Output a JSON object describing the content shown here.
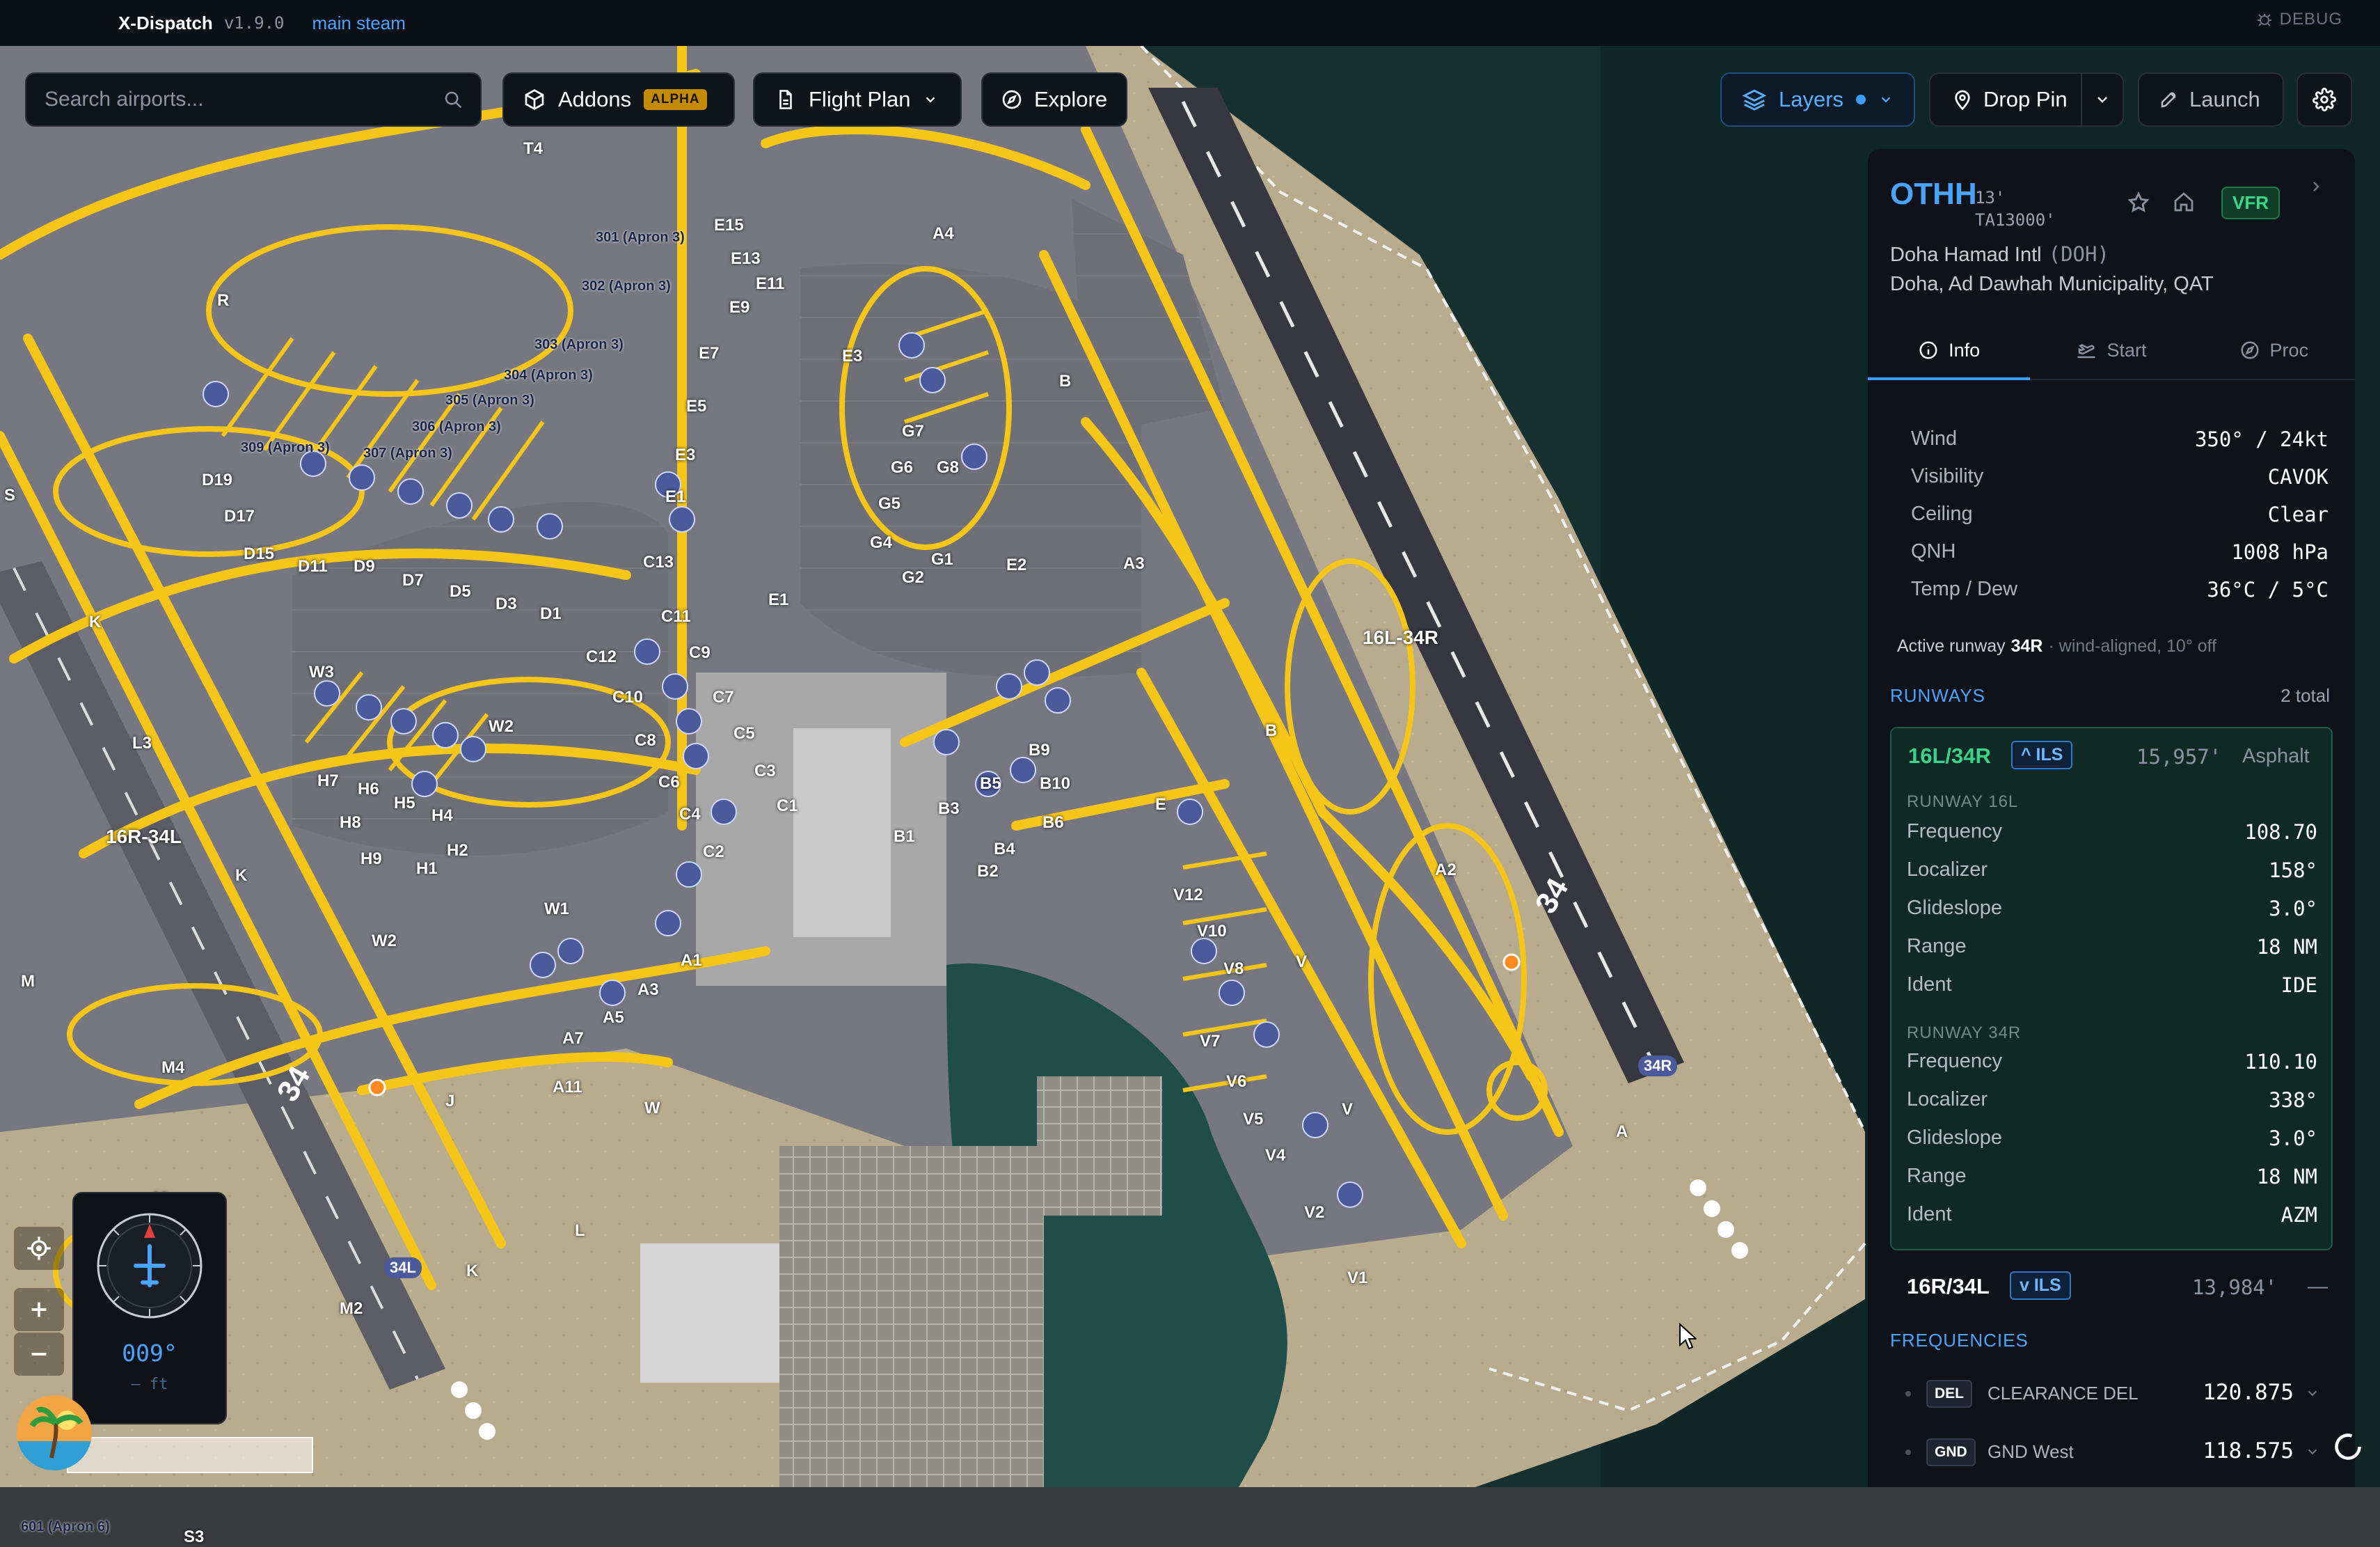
{
  "titlebar": {
    "app": "X-Dispatch",
    "version": "v1.9.0",
    "branch": "main steam",
    "debug": "DEBUG"
  },
  "toolbar": {
    "search_placeholder": "Search airports...",
    "addons": "Addons",
    "addons_badge": "ALPHA",
    "flight_plan": "Flight Plan",
    "explore": "Explore",
    "layers": "Layers",
    "drop_pin": "Drop Pin",
    "launch": "Launch"
  },
  "airport": {
    "icao": "OTHH",
    "elevation": "13'",
    "transition": "TA13000'",
    "flight_rules": "VFR",
    "name": "Doha Hamad Intl",
    "iata": "(DOH)",
    "location": "Doha, Ad Dawhah Municipality, QAT"
  },
  "tabs": [
    {
      "label": "Info",
      "icon": "info-icon"
    },
    {
      "label": "Start",
      "icon": "takeoff-icon"
    },
    {
      "label": "Proc",
      "icon": "compass-icon"
    }
  ],
  "weather": [
    {
      "k": "Wind",
      "v": "350° / 24kt"
    },
    {
      "k": "Visibility",
      "v": "CAVOK"
    },
    {
      "k": "Ceiling",
      "v": "Clear"
    },
    {
      "k": "QNH",
      "v": "1008 hPa"
    },
    {
      "k": "Temp / Dew",
      "v": "36°C / 5°C"
    }
  ],
  "active_runway": {
    "label": "Active runway",
    "value": "34R",
    "note": "· wind-aligned, 10° off"
  },
  "runways_header": {
    "title": "RUNWAYS",
    "count": "2 total"
  },
  "runway1": {
    "id": "16L/34R",
    "ils": "^ ILS",
    "length": "15,957'",
    "surface": "Asphalt",
    "ends": [
      {
        "title": "RUNWAY 16L",
        "rows": [
          {
            "k": "Frequency",
            "v": "108.70"
          },
          {
            "k": "Localizer",
            "v": "158°"
          },
          {
            "k": "Glideslope",
            "v": "3.0°"
          },
          {
            "k": "Range",
            "v": "18 NM"
          },
          {
            "k": "Ident",
            "v": "IDE"
          }
        ]
      },
      {
        "title": "RUNWAY 34R",
        "rows": [
          {
            "k": "Frequency",
            "v": "110.10"
          },
          {
            "k": "Localizer",
            "v": "338°"
          },
          {
            "k": "Glideslope",
            "v": "3.0°"
          },
          {
            "k": "Range",
            "v": "18 NM"
          },
          {
            "k": "Ident",
            "v": "AZM"
          }
        ]
      }
    ]
  },
  "runway2": {
    "id": "16R/34L",
    "ils": "v ILS",
    "length": "13,984'",
    "surface": "—"
  },
  "frequencies_header": "FREQUENCIES",
  "frequencies": [
    {
      "tag": "DEL",
      "name": "CLEARANCE DEL",
      "value": "120.875"
    },
    {
      "tag": "GND",
      "name": "GND West",
      "value": "118.575"
    }
  ],
  "compass": {
    "heading": "009°",
    "altitude": "— ft"
  },
  "map_labels": {
    "runway_main": "16L-34R",
    "runway_west": "16R-34L",
    "rw_num_east": "34",
    "rw_num_west": "34",
    "threshold_east": "34R",
    "threshold_west": "34L",
    "taxiways": [
      {
        "t": "T4"
      },
      {
        "t": "R"
      },
      {
        "t": "S"
      },
      {
        "t": "K"
      },
      {
        "t": "L3"
      },
      {
        "t": "K"
      },
      {
        "t": "M"
      },
      {
        "t": "M4"
      },
      {
        "t": "M"
      },
      {
        "t": "M2"
      },
      {
        "t": "W3"
      },
      {
        "t": "W2"
      },
      {
        "t": "W1"
      },
      {
        "t": "W2"
      },
      {
        "t": "W"
      },
      {
        "t": "J"
      },
      {
        "t": "K"
      },
      {
        "t": "L"
      },
      {
        "t": "A4"
      },
      {
        "t": "E3"
      },
      {
        "t": "E2"
      },
      {
        "t": "E1"
      },
      {
        "t": "A3"
      },
      {
        "t": "B"
      },
      {
        "t": "B"
      },
      {
        "t": "E"
      },
      {
        "t": "A2"
      },
      {
        "t": "A"
      },
      {
        "t": "V"
      },
      {
        "t": "V"
      },
      {
        "t": "D19"
      },
      {
        "t": "D17"
      },
      {
        "t": "D15"
      },
      {
        "t": "D11"
      },
      {
        "t": "D9"
      },
      {
        "t": "D7"
      },
      {
        "t": "D5"
      },
      {
        "t": "D3"
      },
      {
        "t": "D1"
      },
      {
        "t": "C13"
      },
      {
        "t": "C12"
      },
      {
        "t": "C11"
      },
      {
        "t": "C10"
      },
      {
        "t": "C9"
      },
      {
        "t": "C8"
      },
      {
        "t": "C7"
      },
      {
        "t": "C6"
      },
      {
        "t": "C5"
      },
      {
        "t": "C4"
      },
      {
        "t": "C3"
      },
      {
        "t": "C2"
      },
      {
        "t": "C1"
      },
      {
        "t": "H7"
      },
      {
        "t": "H6"
      },
      {
        "t": "H5"
      },
      {
        "t": "H4"
      },
      {
        "t": "H8"
      },
      {
        "t": "H9"
      },
      {
        "t": "H2"
      },
      {
        "t": "H1"
      },
      {
        "t": "G7"
      },
      {
        "t": "G6"
      },
      {
        "t": "G8"
      },
      {
        "t": "G5"
      },
      {
        "t": "G4"
      },
      {
        "t": "G2"
      },
      {
        "t": "G1"
      },
      {
        "t": "B9"
      },
      {
        "t": "B10"
      },
      {
        "t": "B5"
      },
      {
        "t": "B3"
      },
      {
        "t": "B6"
      },
      {
        "t": "B1"
      },
      {
        "t": "B4"
      },
      {
        "t": "B2"
      },
      {
        "t": "A1"
      },
      {
        "t": "A3"
      },
      {
        "t": "A5"
      },
      {
        "t": "A7"
      },
      {
        "t": "A11"
      },
      {
        "t": "V12"
      },
      {
        "t": "V10"
      },
      {
        "t": "V8"
      },
      {
        "t": "V7"
      },
      {
        "t": "V6"
      },
      {
        "t": "V5"
      },
      {
        "t": "V4"
      },
      {
        "t": "V2"
      },
      {
        "t": "V1"
      },
      {
        "t": "E15"
      },
      {
        "t": "E13"
      },
      {
        "t": "E11"
      },
      {
        "t": "E9"
      },
      {
        "t": "E7"
      },
      {
        "t": "E5"
      },
      {
        "t": "E3"
      },
      {
        "t": "E1"
      },
      {
        "t": "301 (Apron 3)"
      },
      {
        "t": "302 (Apron 3)"
      },
      {
        "t": "303 (Apron 3)"
      },
      {
        "t": "304 (Apron 3)"
      },
      {
        "t": "305 (Apron 3)"
      },
      {
        "t": "306 (Apron 3)"
      },
      {
        "t": "307 (Apron 3)"
      },
      {
        "t": "309 (Apron 3)"
      },
      {
        "t": "601 (Apron 6)"
      },
      {
        "t": "S3"
      }
    ]
  },
  "colors": {
    "accent": "#3b9dff",
    "taxiway": "#f5c518",
    "vfr": "#39d98a",
    "runway_card": "#0f2a24"
  }
}
